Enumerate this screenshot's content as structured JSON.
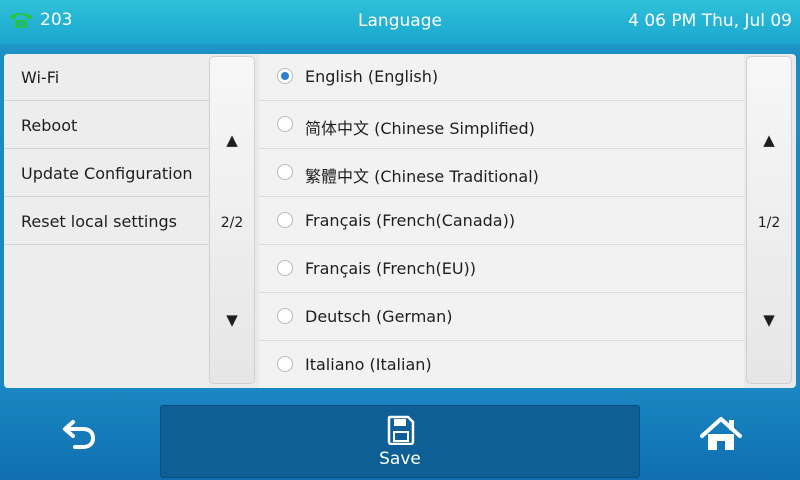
{
  "header": {
    "account": "203",
    "title": "Language",
    "datetime": "4 06 PM Thu, Jul 09"
  },
  "left_menu": {
    "items": [
      {
        "label": "Wi-Fi"
      },
      {
        "label": "Reboot"
      },
      {
        "label": "Update Configuration"
      },
      {
        "label": "Reset local settings"
      }
    ],
    "page_indicator": "2/2"
  },
  "languages": {
    "items": [
      {
        "label": "English (English)",
        "selected": true
      },
      {
        "label": "简体中文 (Chinese Simplified)",
        "selected": false
      },
      {
        "label": "繁體中文 (Chinese Traditional)",
        "selected": false
      },
      {
        "label": "Français (French(Canada))",
        "selected": false
      },
      {
        "label": "Français (French(EU))",
        "selected": false
      },
      {
        "label": "Deutsch (German)",
        "selected": false
      },
      {
        "label": "Italiano (Italian)",
        "selected": false
      }
    ],
    "page_indicator": "1/2"
  },
  "footer": {
    "save_label": "Save"
  },
  "icons": {
    "phone": "phone-icon",
    "up": "arrow-up-icon",
    "down": "arrow-down-icon",
    "back": "back-icon",
    "save": "save-icon",
    "home": "home-icon"
  },
  "colors": {
    "accent": "#2e7fd1",
    "phone_icon": "#26c24a",
    "save_button": "#0d5f96"
  }
}
